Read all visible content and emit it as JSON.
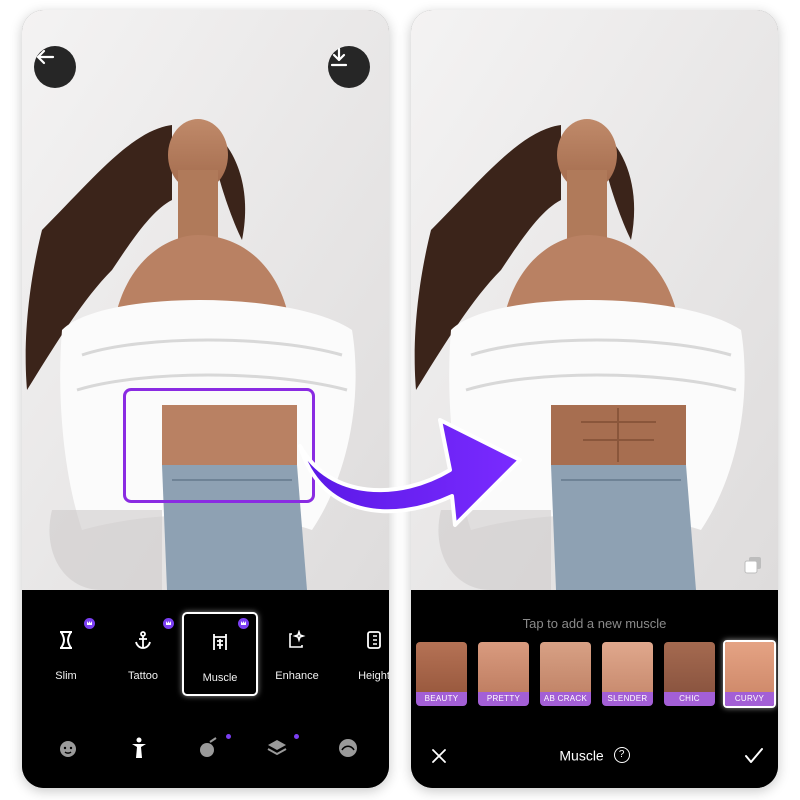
{
  "left_screen": {
    "tools": [
      {
        "label": "Slim",
        "icon": "waist-icon",
        "premium": true
      },
      {
        "label": "Tattoo",
        "icon": "anchor-icon",
        "premium": true
      },
      {
        "label": "Muscle",
        "icon": "muscle-icon",
        "premium": true,
        "selected": true
      },
      {
        "label": "Enhance",
        "icon": "enhance-icon",
        "premium": false
      },
      {
        "label": "Height",
        "icon": "ruler-icon",
        "premium": false
      }
    ],
    "bottom_nav": [
      "face-icon",
      "body-icon",
      "magic-icon",
      "layers-icon",
      "sticker-icon"
    ]
  },
  "right_screen": {
    "hint": "Tap to add a new muscle",
    "presets": [
      {
        "label": "BEAUTY"
      },
      {
        "label": "PRETTY"
      },
      {
        "label": "AB CRACK"
      },
      {
        "label": "SLENDER"
      },
      {
        "label": "CHIC"
      },
      {
        "label": "CURVY",
        "selected": true
      }
    ],
    "title": "Muscle",
    "help_icon": "?"
  },
  "colors": {
    "accent": "#7b3ff2",
    "arrow": "#6a1ff0",
    "highlight_box": "#8a2be2",
    "preset_label_bg": "#a35fd6",
    "panel_bg": "#000000"
  }
}
